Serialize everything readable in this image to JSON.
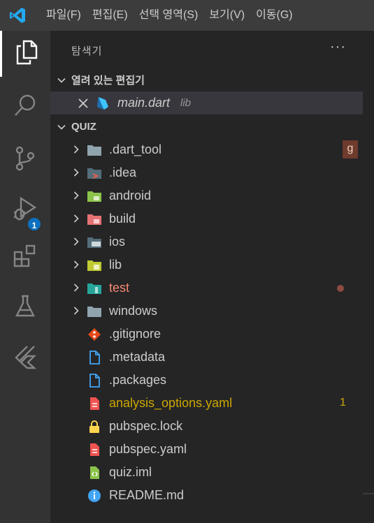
{
  "menu": [
    "파일(F)",
    "편집(E)",
    "선택 영역(S)",
    "보기(V)",
    "이동(G)"
  ],
  "activity": {
    "run_badge": "1"
  },
  "explorer": {
    "title": "탐색기",
    "more": "···",
    "open_editors": {
      "header": "열려 있는 편집기",
      "items": [
        {
          "name": "main.dart",
          "folder": "lib"
        }
      ]
    },
    "project": {
      "header": "QUIZ",
      "folders": [
        {
          "name": ".dart_tool",
          "decoration": "g"
        },
        {
          "name": ".idea"
        },
        {
          "name": "android"
        },
        {
          "name": "build"
        },
        {
          "name": "ios"
        },
        {
          "name": "lib"
        },
        {
          "name": "test",
          "decoration": "●"
        },
        {
          "name": "windows"
        }
      ],
      "files": [
        {
          "name": ".gitignore"
        },
        {
          "name": ".metadata"
        },
        {
          "name": ".packages"
        },
        {
          "name": "analysis_options.yaml",
          "decoration": "1"
        },
        {
          "name": "pubspec.lock"
        },
        {
          "name": "pubspec.yaml"
        },
        {
          "name": "quiz.iml"
        },
        {
          "name": "README.md"
        }
      ]
    }
  },
  "colors": {
    "accent": "#0e70c0",
    "titlebar": "#3c3c3c",
    "activitybar": "#333333",
    "sidebar": "#252526",
    "error": "#f48771",
    "warning": "#cca700"
  }
}
